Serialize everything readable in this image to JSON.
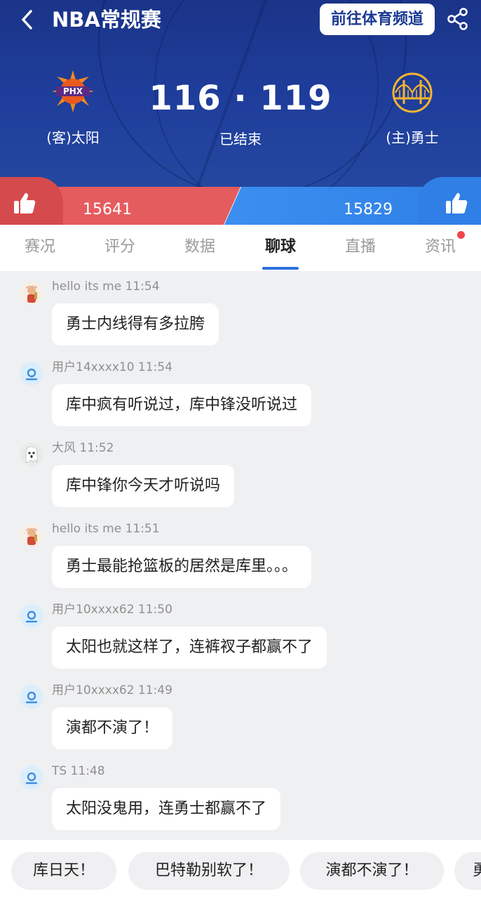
{
  "header": {
    "title": "NBA常规赛",
    "channel_button": "前往体育频道",
    "back_icon": "chevron-left-icon",
    "share_icon": "share-icon"
  },
  "game": {
    "away_team": "(客)太阳",
    "home_team": "(主)勇士",
    "away_logo": "PHX",
    "score": "116 · 119",
    "status": "已结束"
  },
  "votes": {
    "away_count": "15641",
    "home_count": "15829",
    "away_color": "#e55c5f",
    "home_color": "#2f7fe6"
  },
  "tabs": [
    {
      "label": "赛况"
    },
    {
      "label": "评分"
    },
    {
      "label": "数据"
    },
    {
      "label": "聊球"
    },
    {
      "label": "直播"
    },
    {
      "label": "资讯"
    }
  ],
  "active_tab": "聊球",
  "messages": [
    {
      "user": "hello its me",
      "time": "11:54",
      "text": "勇士内线得有多拉胯",
      "avatar": "cartoon-avatar"
    },
    {
      "user": "用户14xxxx10",
      "time": "11:54",
      "text": "库中疯有听说过，库中锋没听说过",
      "avatar": "default-user-icon"
    },
    {
      "user": "大风",
      "time": "11:52",
      "text": "库中锋你今天才听说吗",
      "avatar": "ghost-avatar"
    },
    {
      "user": "hello its me",
      "time": "11:51",
      "text": "勇士最能抢篮板的居然是库里。。。",
      "avatar": "cartoon-avatar"
    },
    {
      "user": "用户10xxxx62",
      "time": "11:50",
      "text": "太阳也就这样了，连裤衩子都赢不了",
      "avatar": "default-user-icon"
    },
    {
      "user": "用户10xxxx62",
      "time": "11:49",
      "text": "演都不演了！",
      "avatar": "default-user-icon"
    },
    {
      "user": "TS",
      "time": "11:48",
      "text": "太阳没鬼用，连勇士都赢不了",
      "avatar": "default-user-icon"
    }
  ],
  "quick_replies": [
    "库日天！",
    "巴特勒别软了！",
    "演都不演了！",
    "勇"
  ]
}
